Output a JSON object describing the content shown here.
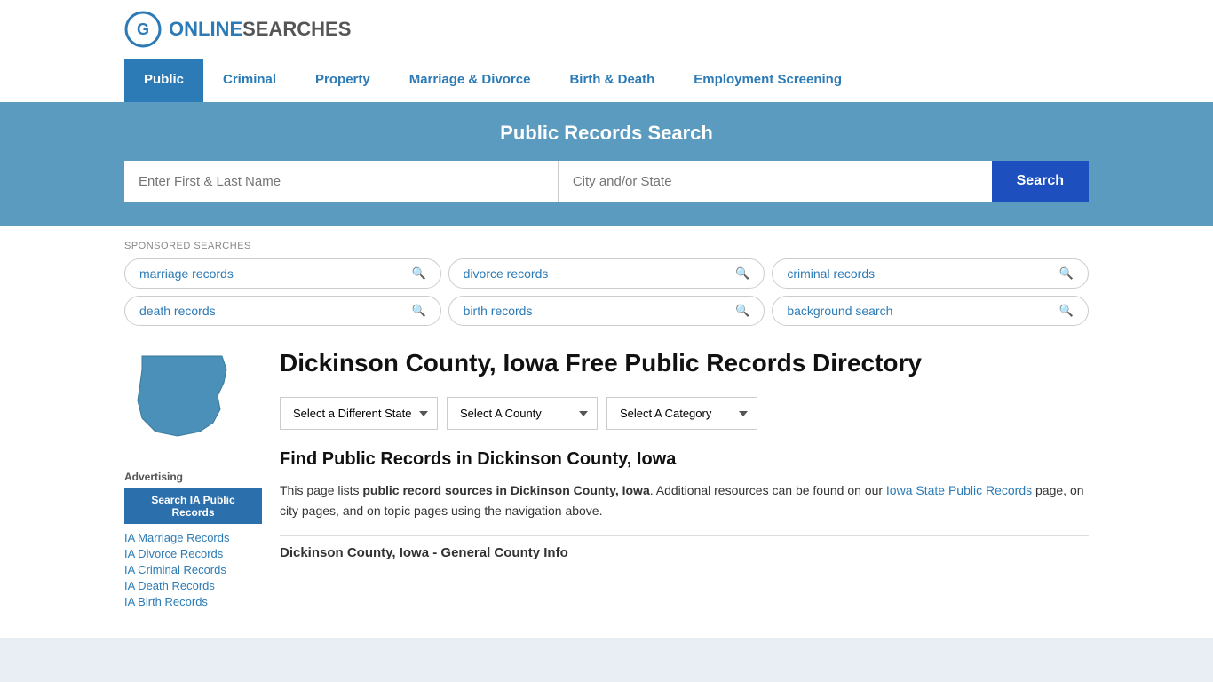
{
  "header": {
    "logo_online": "ONLINE",
    "logo_searches": "SEARCHES"
  },
  "nav": {
    "items": [
      {
        "label": "Public",
        "active": true
      },
      {
        "label": "Criminal",
        "active": false
      },
      {
        "label": "Property",
        "active": false
      },
      {
        "label": "Marriage & Divorce",
        "active": false
      },
      {
        "label": "Birth & Death",
        "active": false
      },
      {
        "label": "Employment Screening",
        "active": false
      }
    ]
  },
  "search_section": {
    "title": "Public Records Search",
    "name_placeholder": "Enter First & Last Name",
    "location_placeholder": "City and/or State",
    "button_label": "Search"
  },
  "sponsored": {
    "label": "SPONSORED SEARCHES",
    "items": [
      "marriage records",
      "divorce records",
      "criminal records",
      "death records",
      "birth records",
      "background search"
    ]
  },
  "page": {
    "title": "Dickinson County, Iowa Free Public Records Directory",
    "dropdowns": {
      "state": "Select a Different State",
      "county": "Select A County",
      "category": "Select A Category"
    },
    "find_title": "Find Public Records in Dickinson County, Iowa",
    "find_desc_1": "This page lists ",
    "find_desc_bold": "public record sources in Dickinson County, Iowa",
    "find_desc_2": ". Additional resources can be found on our ",
    "find_link": "Iowa State Public Records",
    "find_desc_3": " page, on city pages, and on topic pages using the navigation above.",
    "county_info_header": "Dickinson County, Iowa - General County Info"
  },
  "sidebar": {
    "advertising_label": "Advertising",
    "search_btn": "Search IA Public Records",
    "links": [
      "IA Marriage Records",
      "IA Divorce Records",
      "IA Criminal Records",
      "IA Death Records",
      "IA Birth Records"
    ]
  }
}
